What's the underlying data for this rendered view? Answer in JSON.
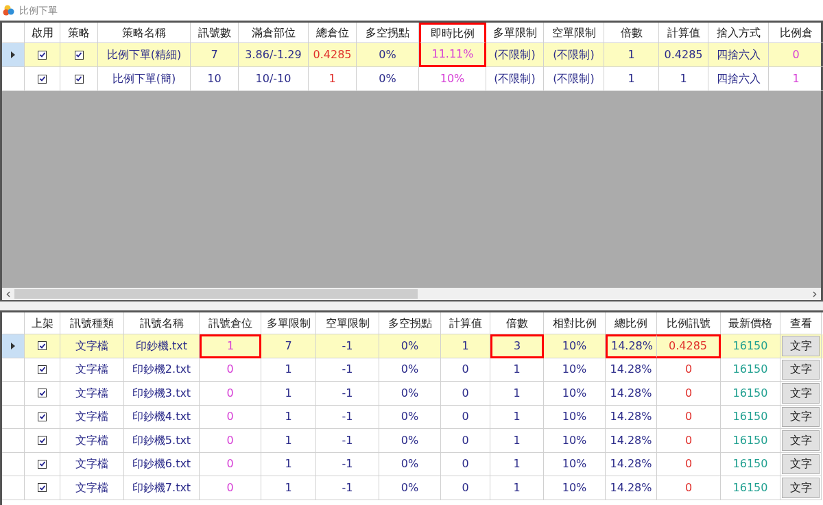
{
  "window": {
    "title": "比例下單"
  },
  "strategy_table": {
    "columns": [
      {
        "label": "啟用",
        "kind": "checkbox"
      },
      {
        "label": "策略",
        "kind": "checkbox"
      },
      {
        "label": "策略名稱",
        "kind": "text"
      },
      {
        "label": "訊號數",
        "kind": "text"
      },
      {
        "label": "滿倉部位",
        "kind": "text"
      },
      {
        "label": "總倉位",
        "kind": "text",
        "color": "#e0302c"
      },
      {
        "label": "多空拐點",
        "kind": "text"
      },
      {
        "label": "即時比例",
        "kind": "text",
        "color": "#d63fd6"
      },
      {
        "label": "多單限制",
        "kind": "text"
      },
      {
        "label": "空單限制",
        "kind": "text"
      },
      {
        "label": "倍數",
        "kind": "text"
      },
      {
        "label": "計算值",
        "kind": "text"
      },
      {
        "label": "捨入方式",
        "kind": "text"
      },
      {
        "label": "比例倉",
        "kind": "text",
        "color": "#d63fd6"
      }
    ],
    "header_highlight": [
      false,
      false,
      false,
      false,
      false,
      false,
      false,
      true,
      false,
      false,
      false,
      false,
      false,
      false
    ],
    "rows": [
      {
        "selected": true,
        "cells": [
          true,
          true,
          "比例下單(精細)",
          "7",
          "3.86/-1.29",
          "0.4285",
          "0%",
          "11.11%",
          "(不限制)",
          "(不限制)",
          "1",
          "0.4285",
          "四捨六入",
          "0"
        ],
        "highlight": [
          false,
          false,
          false,
          false,
          false,
          false,
          false,
          true,
          false,
          false,
          false,
          false,
          false,
          false
        ]
      },
      {
        "selected": false,
        "cells": [
          true,
          true,
          "比例下單(簡)",
          "10",
          "10/-10",
          "1",
          "0%",
          "10%",
          "(不限制)",
          "(不限制)",
          "1",
          "1",
          "四捨六入",
          "1"
        ],
        "highlight": [
          false,
          false,
          false,
          false,
          false,
          false,
          false,
          false,
          false,
          false,
          false,
          false,
          false,
          false
        ]
      }
    ]
  },
  "signal_table": {
    "columns": [
      {
        "label": "上架",
        "kind": "checkbox"
      },
      {
        "label": "訊號種類",
        "kind": "text"
      },
      {
        "label": "訊號名稱",
        "kind": "text"
      },
      {
        "label": "訊號倉位",
        "kind": "text",
        "color": "#d63fd6"
      },
      {
        "label": "多單限制",
        "kind": "text"
      },
      {
        "label": "空單限制",
        "kind": "text"
      },
      {
        "label": "多空拐點",
        "kind": "text"
      },
      {
        "label": "計算值",
        "kind": "text"
      },
      {
        "label": "倍數",
        "kind": "text"
      },
      {
        "label": "相對比例",
        "kind": "text"
      },
      {
        "label": "總比例",
        "kind": "text"
      },
      {
        "label": "比例訊號",
        "kind": "text",
        "color": "#e0302c"
      },
      {
        "label": "最新價格",
        "kind": "text",
        "color": "#20a090"
      },
      {
        "label": "查看",
        "kind": "button"
      }
    ],
    "header_highlight": [
      false,
      false,
      false,
      false,
      false,
      false,
      false,
      false,
      false,
      false,
      false,
      false,
      false,
      false
    ],
    "rows": [
      {
        "selected": true,
        "cells": [
          true,
          "文字檔",
          "印鈔機.txt",
          "1",
          "7",
          "-1",
          "0%",
          "1",
          "3",
          "10%",
          "14.28%",
          "0.4285",
          "16150",
          "文字"
        ],
        "highlight": [
          false,
          false,
          false,
          true,
          false,
          false,
          false,
          false,
          true,
          false,
          true,
          true,
          false,
          false
        ]
      },
      {
        "selected": false,
        "cells": [
          true,
          "文字檔",
          "印鈔機2.txt",
          "0",
          "1",
          "-1",
          "0%",
          "0",
          "1",
          "10%",
          "14.28%",
          "0",
          "16150",
          "文字"
        ],
        "highlight": [
          false,
          false,
          false,
          false,
          false,
          false,
          false,
          false,
          false,
          false,
          false,
          false,
          false,
          false
        ]
      },
      {
        "selected": false,
        "cells": [
          true,
          "文字檔",
          "印鈔機3.txt",
          "0",
          "1",
          "-1",
          "0%",
          "0",
          "1",
          "10%",
          "14.28%",
          "0",
          "16150",
          "文字"
        ],
        "highlight": [
          false,
          false,
          false,
          false,
          false,
          false,
          false,
          false,
          false,
          false,
          false,
          false,
          false,
          false
        ]
      },
      {
        "selected": false,
        "cells": [
          true,
          "文字檔",
          "印鈔機4.txt",
          "0",
          "1",
          "-1",
          "0%",
          "0",
          "1",
          "10%",
          "14.28%",
          "0",
          "16150",
          "文字"
        ],
        "highlight": [
          false,
          false,
          false,
          false,
          false,
          false,
          false,
          false,
          false,
          false,
          false,
          false,
          false,
          false
        ]
      },
      {
        "selected": false,
        "cells": [
          true,
          "文字檔",
          "印鈔機5.txt",
          "0",
          "1",
          "-1",
          "0%",
          "0",
          "1",
          "10%",
          "14.28%",
          "0",
          "16150",
          "文字"
        ],
        "highlight": [
          false,
          false,
          false,
          false,
          false,
          false,
          false,
          false,
          false,
          false,
          false,
          false,
          false,
          false
        ]
      },
      {
        "selected": false,
        "cells": [
          true,
          "文字檔",
          "印鈔機6.txt",
          "0",
          "1",
          "-1",
          "0%",
          "0",
          "1",
          "10%",
          "14.28%",
          "0",
          "16150",
          "文字"
        ],
        "highlight": [
          false,
          false,
          false,
          false,
          false,
          false,
          false,
          false,
          false,
          false,
          false,
          false,
          false,
          false
        ]
      },
      {
        "selected": false,
        "cells": [
          true,
          "文字檔",
          "印鈔機7.txt",
          "0",
          "1",
          "-1",
          "0%",
          "0",
          "1",
          "10%",
          "14.28%",
          "0",
          "16150",
          "文字"
        ],
        "highlight": [
          false,
          false,
          false,
          false,
          false,
          false,
          false,
          false,
          false,
          false,
          false,
          false,
          false,
          false
        ]
      }
    ]
  }
}
